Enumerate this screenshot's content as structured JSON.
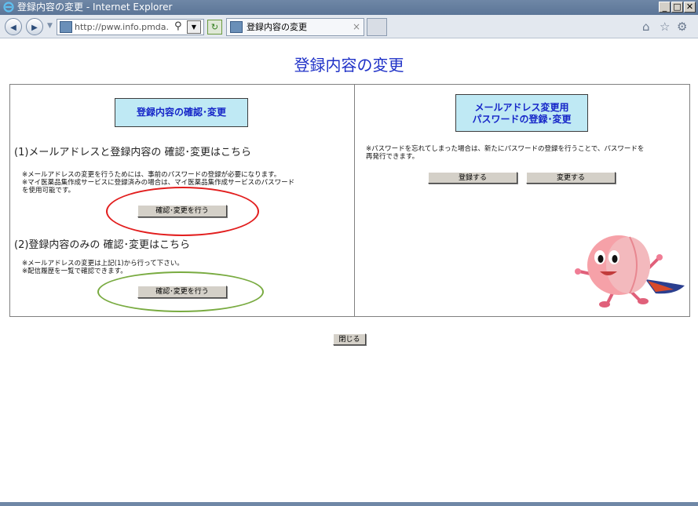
{
  "window": {
    "title": "登録内容の変更 - Internet Explorer",
    "minimize_glyph": "_",
    "maximize_glyph": "□",
    "close_glyph": "✕"
  },
  "navbar": {
    "back_glyph": "◀",
    "forward_glyph": "▶",
    "address": "http://pww.info.pmda.go.jp/pu",
    "tab_title": "登録内容の変更",
    "tab_close": "×",
    "home_icon": "home-icon",
    "star_icon": "star-icon",
    "gear_icon": "gear-icon"
  },
  "page": {
    "title": "登録内容の変更",
    "left": {
      "heading": "登録内容の確認･変更",
      "section1_title": "(1)メールアドレスと登録内容の 確認･変更はこちら",
      "section1_note1": "※メールアドレスの変更を行うためには、事前のパスワードの登録が必要になります。",
      "section1_note2": "※マイ医薬品集作成サービスに登録済みの場合は、マイ医薬品集作成サービスのパスワード",
      "section1_note3": "を使用可能です。",
      "section1_button": "確認･変更を行う",
      "section2_title": "(2)登録内容のみの 確認･変更はこちら",
      "section2_note1": "※メールアドレスの変更は上記(1)から行って下さい。",
      "section2_note2": "※配信履歴を一覧で確認できます。",
      "section2_button": "確認･変更を行う"
    },
    "right": {
      "heading_line1": "メールアドレス変更用",
      "heading_line2": "パスワードの登録･変更",
      "note1": "※パスワードを忘れてしまった場合は、新たにパスワードの登録を行うことで、パスワードを",
      "note2": "再発行できます。",
      "register_button": "登録する",
      "change_button": "変更する"
    },
    "close_button": "閉じる"
  },
  "colors": {
    "title_blue": "#1f31c7",
    "heading_bg": "#bfe9f4",
    "ring_red": "#e21e1e",
    "ring_green": "#79ab41"
  }
}
